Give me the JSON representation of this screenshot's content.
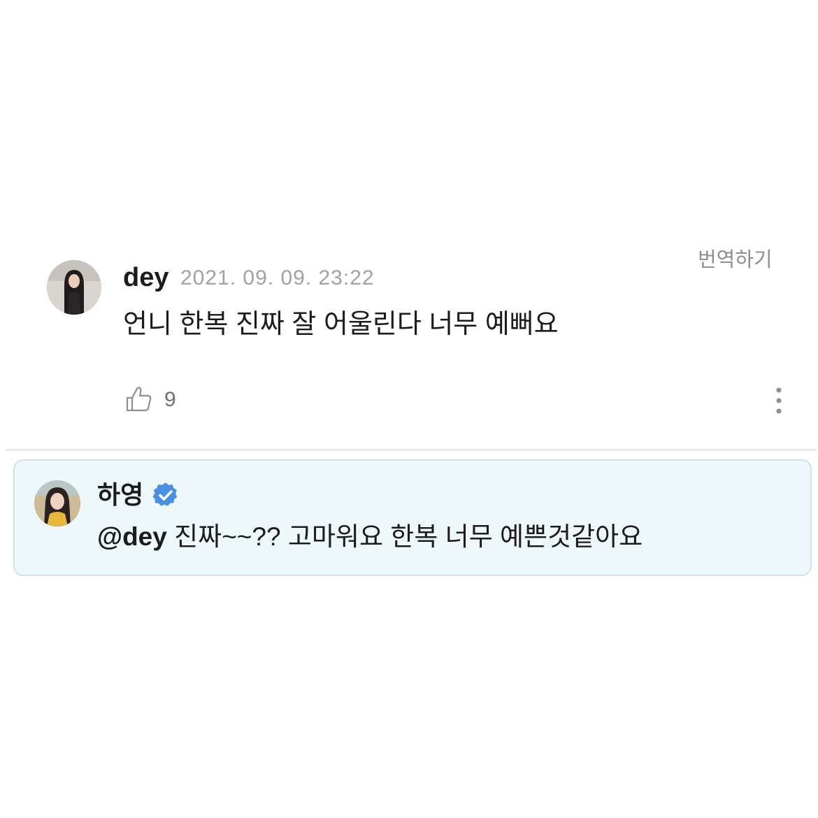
{
  "comment": {
    "author": "dey",
    "timestamp": "2021. 09. 09. 23:22",
    "translate_label": "번역하기",
    "body": "언니 한복 진짜 잘 어울린다 너무 예뻐요",
    "like_count": "9",
    "avatar_icon": "user-avatar"
  },
  "reply": {
    "author": "하영",
    "verified": true,
    "verified_icon": "verified-badge-icon",
    "mention": "@dey",
    "body": " 진짜~~?? 고마워요 한복 너무 예쁜것같아요",
    "background_color": "#eef7fc",
    "border_color": "#cde2ea",
    "badge_color": "#4a90e2"
  }
}
